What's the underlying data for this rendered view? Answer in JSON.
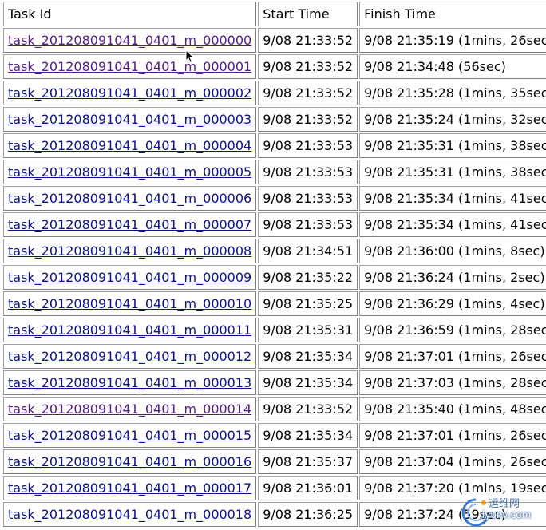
{
  "headers": [
    "Task Id",
    "Start Time",
    "Finish Time"
  ],
  "rows": [
    {
      "task_id": "task_201208091041_0401_m_000000",
      "start": "9/08 21:33:52",
      "finish": "9/08 21:35:19 (1mins, 26sec)",
      "visited": true
    },
    {
      "task_id": "task_201208091041_0401_m_000001",
      "start": "9/08 21:33:52",
      "finish": "9/08 21:34:48 (56sec)",
      "visited": true
    },
    {
      "task_id": "task_201208091041_0401_m_000002",
      "start": "9/08 21:33:52",
      "finish": "9/08 21:35:28 (1mins, 35sec)",
      "visited": false
    },
    {
      "task_id": "task_201208091041_0401_m_000003",
      "start": "9/08 21:33:52",
      "finish": "9/08 21:35:24 (1mins, 32sec)",
      "visited": false
    },
    {
      "task_id": "task_201208091041_0401_m_000004",
      "start": "9/08 21:33:53",
      "finish": "9/08 21:35:31 (1mins, 38sec)",
      "visited": false
    },
    {
      "task_id": "task_201208091041_0401_m_000005",
      "start": "9/08 21:33:53",
      "finish": "9/08 21:35:31 (1mins, 38sec)",
      "visited": false
    },
    {
      "task_id": "task_201208091041_0401_m_000006",
      "start": "9/08 21:33:53",
      "finish": "9/08 21:35:34 (1mins, 41sec)",
      "visited": false
    },
    {
      "task_id": "task_201208091041_0401_m_000007",
      "start": "9/08 21:33:53",
      "finish": "9/08 21:35:34 (1mins, 41sec)",
      "visited": false
    },
    {
      "task_id": "task_201208091041_0401_m_000008",
      "start": "9/08 21:34:51",
      "finish": "9/08 21:36:00 (1mins, 8sec)",
      "visited": false
    },
    {
      "task_id": "task_201208091041_0401_m_000009",
      "start": "9/08 21:35:22",
      "finish": "9/08 21:36:24 (1mins, 2sec)",
      "visited": false
    },
    {
      "task_id": "task_201208091041_0401_m_000010",
      "start": "9/08 21:35:25",
      "finish": "9/08 21:36:29 (1mins, 4sec)",
      "visited": false
    },
    {
      "task_id": "task_201208091041_0401_m_000011",
      "start": "9/08 21:35:31",
      "finish": "9/08 21:36:59 (1mins, 28sec)",
      "visited": false
    },
    {
      "task_id": "task_201208091041_0401_m_000012",
      "start": "9/08 21:35:34",
      "finish": "9/08 21:37:01 (1mins, 26sec)",
      "visited": false
    },
    {
      "task_id": "task_201208091041_0401_m_000013",
      "start": "9/08 21:35:34",
      "finish": "9/08 21:37:03 (1mins, 28sec)",
      "visited": false
    },
    {
      "task_id": "task_201208091041_0401_m_000014",
      "start": "9/08 21:33:52",
      "finish": "9/08 21:35:40 (1mins, 48sec)",
      "visited": true
    },
    {
      "task_id": "task_201208091041_0401_m_000015",
      "start": "9/08 21:35:34",
      "finish": "9/08 21:37:01 (1mins, 26sec)",
      "visited": false
    },
    {
      "task_id": "task_201208091041_0401_m_000016",
      "start": "9/08 21:35:37",
      "finish": "9/08 21:37:04 (1mins, 26sec)",
      "visited": false
    },
    {
      "task_id": "task_201208091041_0401_m_000017",
      "start": "9/08 21:36:01",
      "finish": "9/08 21:37:20 (1mins, 19sec)",
      "visited": false
    },
    {
      "task_id": "task_201208091041_0401_m_000018",
      "start": "9/08 21:36:25",
      "finish": "9/08 21:37:24 (59sec)",
      "visited": false
    }
  ],
  "watermark": {
    "line1": "运维网",
    "line2": "iyunv.com"
  },
  "colors": {
    "link": "#0b108c",
    "visited_link": "#551a8b",
    "border": "#808080"
  },
  "icons": {
    "cursor": "arrow-cursor-icon",
    "watermark_logo": "swirl-logo-icon"
  }
}
